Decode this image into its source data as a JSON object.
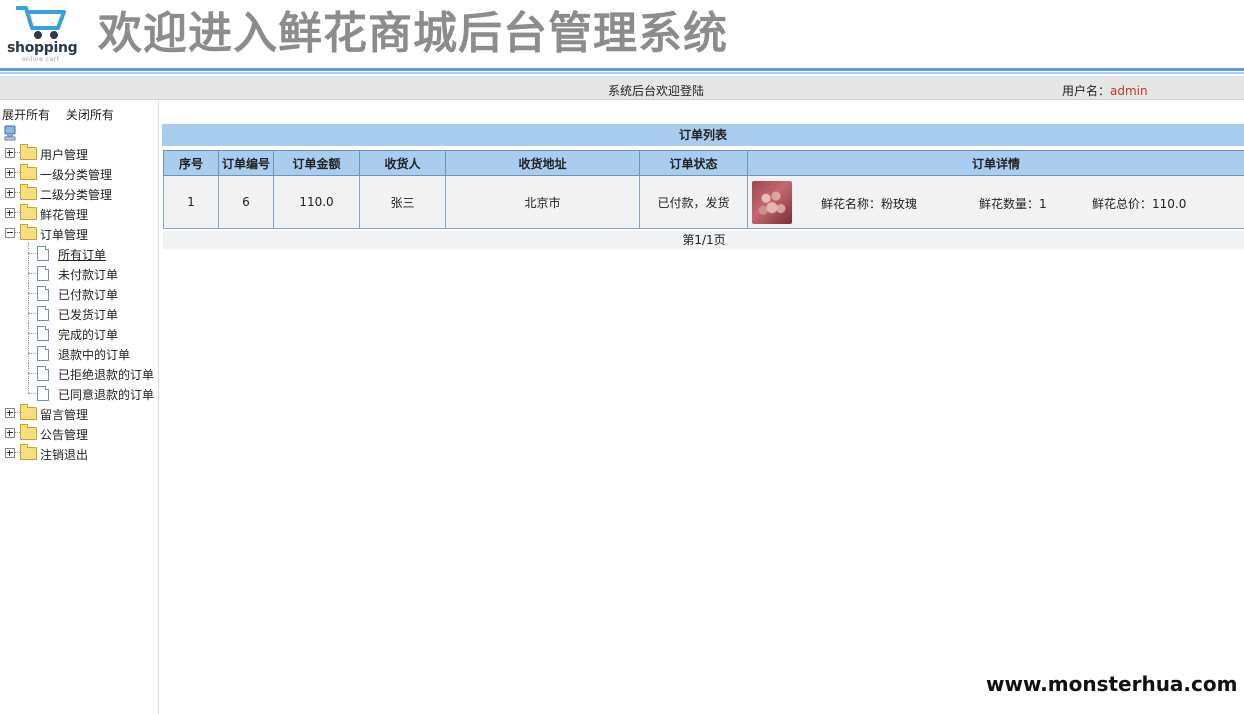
{
  "header": {
    "logo_text": "shopping",
    "logo_sub": "online cart",
    "title": "欢迎进入鲜花商城后台管理系统"
  },
  "infobar": {
    "welcome": "系统后台欢迎登陆",
    "user_label": "用户名：",
    "user_name": "admin"
  },
  "sidebar": {
    "expand_all": "展开所有",
    "collapse_all": "关闭所有",
    "nodes": [
      {
        "label": "用户管理"
      },
      {
        "label": "一级分类管理"
      },
      {
        "label": "二级分类管理"
      },
      {
        "label": "鲜花管理"
      },
      {
        "label": "订单管理",
        "children": [
          "所有订单",
          "未付款订单",
          "已付款订单",
          "已发货订单",
          "完成的订单",
          "退款中的订单",
          "已拒绝退款的订单",
          "已同意退款的订单"
        ]
      },
      {
        "label": "留言管理"
      },
      {
        "label": "公告管理"
      },
      {
        "label": "注销退出"
      }
    ]
  },
  "orders": {
    "title": "订单列表",
    "columns": [
      "序号",
      "订单编号",
      "订单金额",
      "收货人",
      "收货地址",
      "订单状态",
      "订单详情"
    ],
    "rows": [
      {
        "index": "1",
        "order_no": "6",
        "amount": "110.0",
        "receiver": "张三",
        "address": "北京市",
        "status": "已付款，发货",
        "detail": {
          "flower_name": "鲜花名称：粉玫瑰",
          "quantity": "鲜花数量：1",
          "total": "鲜花总价：110.0"
        }
      }
    ],
    "pager": "第1/1页"
  },
  "watermark": "www.monsterhua.com",
  "colors": {
    "accent_blue": "#a9cdee",
    "header_line": "#5b9fd6",
    "username_red": "#c0392b"
  }
}
